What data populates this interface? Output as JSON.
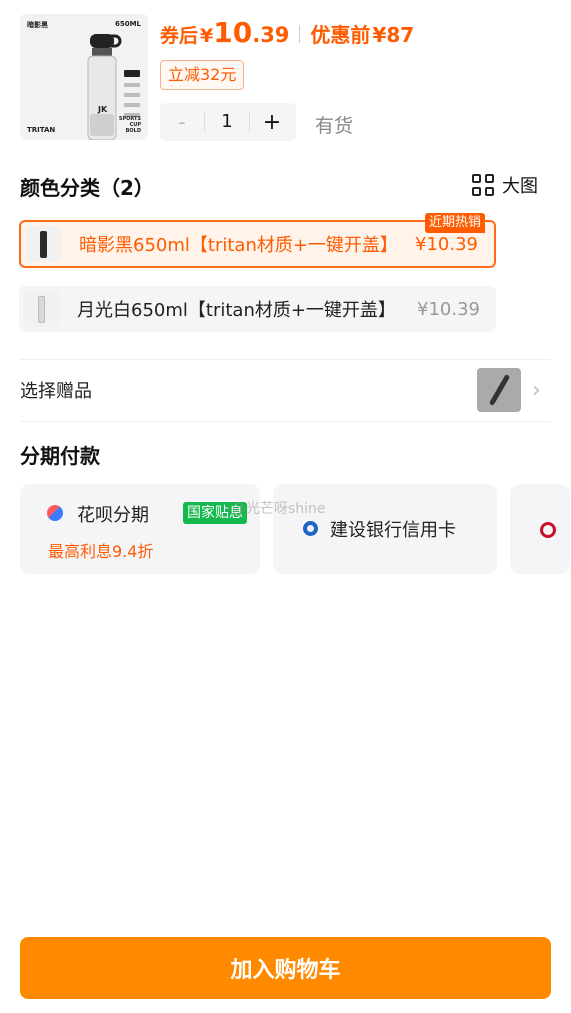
{
  "product": {
    "thumb": {
      "label_tl": "暗影黑",
      "label_tr": "650ML",
      "label_bl": "TRITAN",
      "label_br": "SPORTS CUP BOLD"
    },
    "price_after_coupon_label": "券后",
    "currency": "¥",
    "price_int": "10",
    "price_dec": ".39",
    "original_label": "优惠前",
    "original_price": "87",
    "coupon_label": "立减32元",
    "quantity": "1",
    "minus_label": "-",
    "plus_label": "+",
    "stock_label": "有货"
  },
  "colors": {
    "title": "颜色分类（2）",
    "big_view_label": "大图",
    "hot_tag": "近期热销",
    "options": [
      {
        "name": "暗影黑650ml【tritan材质+一键开盖】",
        "price": "¥10.39",
        "selected": true,
        "bottle_color": "#2a2a2a"
      },
      {
        "name": "月光白650ml【tritan材质+一键开盖】",
        "price": "¥10.39",
        "selected": false,
        "bottle_color": "#d9d9d9"
      }
    ]
  },
  "gift": {
    "label": "选择赠品"
  },
  "installment": {
    "title": "分期付款",
    "cards": [
      {
        "name": "花呗分期",
        "tag": "国家贴息",
        "sub": "最高利息9.4折"
      },
      {
        "name": "建设银行信用卡"
      },
      {
        "name": ""
      }
    ],
    "watermark": "@光芒呀shine"
  },
  "cart_button": "加入购物车",
  "colors_theme": {
    "accent": "#ff5b00",
    "button": "#ff8a00",
    "tag_green": "#13b94d"
  }
}
